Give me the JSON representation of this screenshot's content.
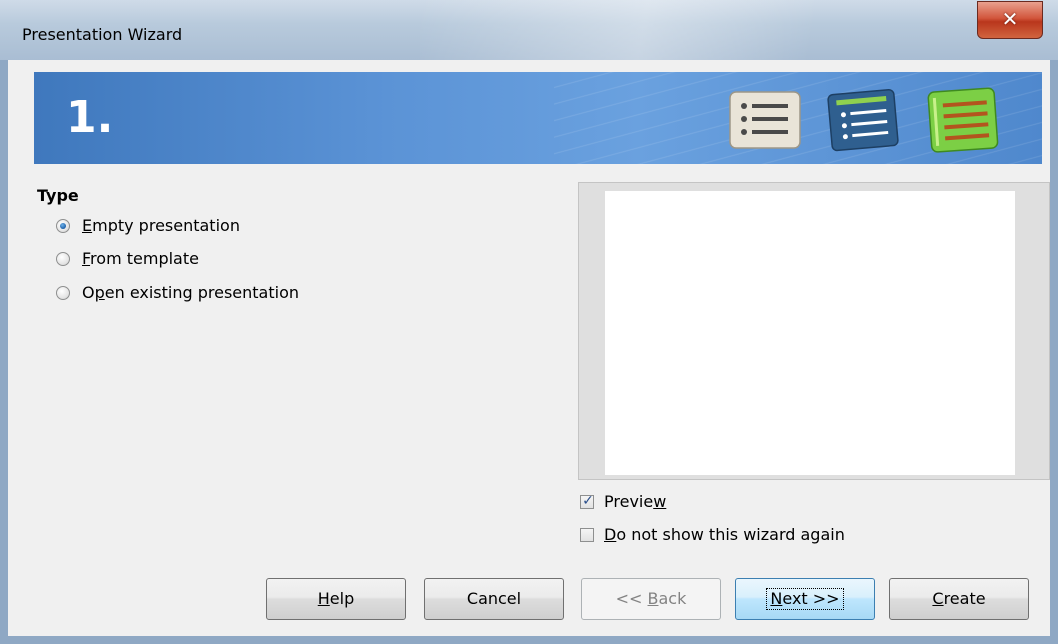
{
  "window": {
    "title": "Presentation Wizard"
  },
  "banner": {
    "step": "1.",
    "icons": [
      "list-icon",
      "list-blue-icon",
      "list-green-icon"
    ]
  },
  "type_group": {
    "label": "Type",
    "options": [
      {
        "mnemonic": "E",
        "rest": "mpty presentation",
        "selected": true
      },
      {
        "mnemonic": "F",
        "rest": "rom template",
        "selected": false
      },
      {
        "prefix": "O",
        "mnemonic": "p",
        "rest": "en existing presentation",
        "selected": false
      }
    ]
  },
  "preview": {
    "preview_checkbox": {
      "prefix": "Previe",
      "mnemonic": "w",
      "checked": true
    },
    "dont_show_checkbox": {
      "mnemonic": "D",
      "rest": "o not show this wizard again",
      "checked": false
    }
  },
  "buttons": {
    "help": {
      "mnemonic": "H",
      "rest": "elp"
    },
    "cancel": {
      "label": "Cancel"
    },
    "back": {
      "prefix": "<< ",
      "mnemonic": "B",
      "rest": "ack",
      "enabled": false
    },
    "next": {
      "mnemonic": "N",
      "rest": "ext >>"
    },
    "create": {
      "mnemonic": "C",
      "rest": "reate"
    }
  },
  "colors": {
    "banner": "#5b93d6",
    "close_button": "#d2563c",
    "dialog_bg": "#f0f0f0"
  }
}
